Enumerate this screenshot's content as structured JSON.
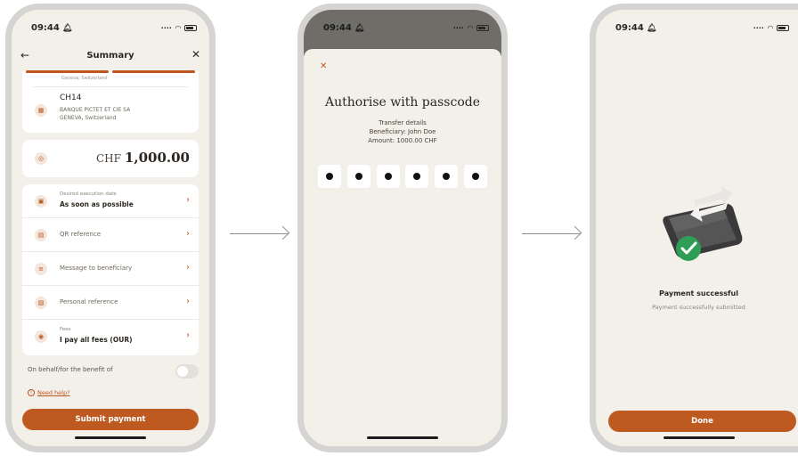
{
  "status_time": "09:44",
  "screen1": {
    "title": "Summary",
    "account_faint": "Geneva, Switzerland",
    "iban": "CH14",
    "bank_line1": "BANQUE PICTET ET CIE SA",
    "bank_line2": "GENEVA, Switzerland",
    "currency": "CHF",
    "amount": "1,000.00",
    "rows": [
      {
        "sub": "Desired execution date",
        "value": "As soon as possible"
      },
      {
        "label": "QR reference"
      },
      {
        "label": "Message to beneficiary"
      },
      {
        "label": "Personal reference"
      },
      {
        "sub": "Fees",
        "value": "I pay all fees (OUR)"
      }
    ],
    "on_behalf_label": "On behalf/for the benefit of",
    "on_behalf_enabled": false,
    "help_link": "Need help?",
    "submit_button": "Submit payment"
  },
  "screen2": {
    "title": "Authorise with passcode",
    "details_heading": "Transfer details",
    "beneficiary": "Beneficiary: John Doe",
    "amount": "Amount: 1000.00 CHF",
    "pin_filled": 6
  },
  "screen3": {
    "title": "Payment successful",
    "subtitle": "Payment successfully submitted",
    "done_button": "Done"
  },
  "colors": {
    "accent": "#be5a20",
    "background": "#f3f0ea",
    "success": "#2e9e57"
  }
}
